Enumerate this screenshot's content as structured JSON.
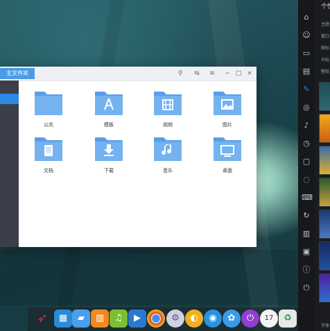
{
  "window": {
    "tab_title": "主文件夹",
    "buttons": [
      "search-icon",
      "view-icon",
      "menu-icon",
      "minimize-icon",
      "maximize-icon",
      "close-icon"
    ]
  },
  "folders": [
    {
      "label": "公共",
      "icon": "share-icon"
    },
    {
      "label": "模板",
      "icon": "compass-icon"
    },
    {
      "label": "视频",
      "icon": "film-icon"
    },
    {
      "label": "图片",
      "icon": "image-icon"
    },
    {
      "label": "文档",
      "icon": "document-icon"
    },
    {
      "label": "下载",
      "icon": "download-icon"
    },
    {
      "label": "音乐",
      "icon": "music-icon"
    },
    {
      "label": "桌面",
      "icon": "desktop-icon"
    }
  ],
  "control_center": {
    "title": "个性",
    "items": [
      "主题",
      "窗口",
      "图标",
      "光标",
      "壁纸"
    ],
    "footer": "字体"
  },
  "dock": {
    "apps": [
      "launcher-icon",
      "multitask-icon",
      "file-manager-icon",
      "app-store-icon",
      "music-player-icon",
      "video-player-icon",
      "chrome-icon",
      "settings-icon",
      "uos-icon",
      "browser-icon",
      "apps-icon",
      "power-icon",
      "calendar-icon",
      "trash-icon"
    ],
    "calendar_date": "17"
  }
}
